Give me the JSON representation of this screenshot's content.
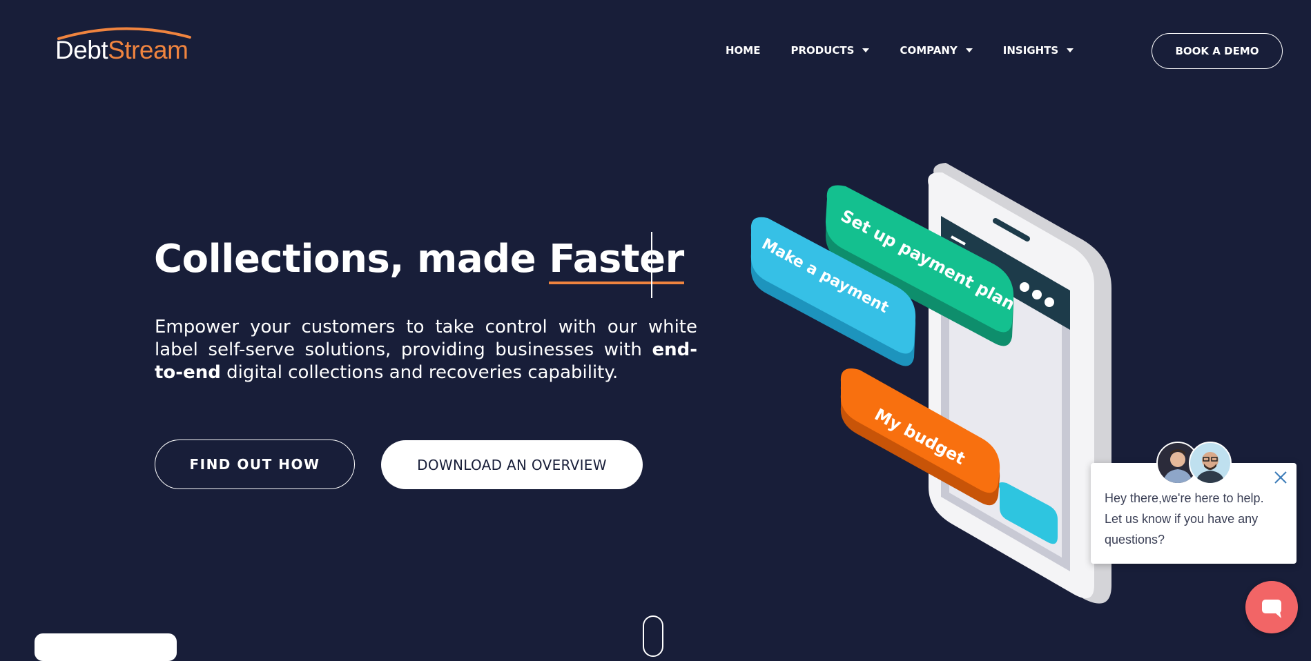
{
  "brand": {
    "logo_part1": "Debt",
    "logo_part2": "Stream",
    "accent_color": "#f0843f",
    "background_color": "#181e39"
  },
  "nav": {
    "items": [
      {
        "label": "HOME",
        "has_dropdown": false
      },
      {
        "label": "PRODUCTS",
        "has_dropdown": true
      },
      {
        "label": "COMPANY",
        "has_dropdown": true
      },
      {
        "label": "INSIGHTS",
        "has_dropdown": true
      }
    ],
    "cta_label": "BOOK A DEMO"
  },
  "hero": {
    "title_prefix": "Collections, made ",
    "title_accent": "Faster",
    "description_part1": "Empower your customers to take control with our white label self-serve solutions, providing businesses with ",
    "description_bold": "end-to-end",
    "description_part2": " digital collections and recoveries capability.",
    "primary_button": "FIND OUT HOW",
    "secondary_button": "DOWNLOAD AN OVERVIEW"
  },
  "illustration": {
    "labels": [
      "Set up payment plan",
      "Make a payment",
      "My budget"
    ],
    "colors": {
      "green": "#12b48a",
      "blue": "#33b6e0",
      "orange": "#f26a0f"
    }
  },
  "chat": {
    "message": "Hey there,we're here to help. Let us know if you have any questions?",
    "launcher_color": "#f26566"
  }
}
